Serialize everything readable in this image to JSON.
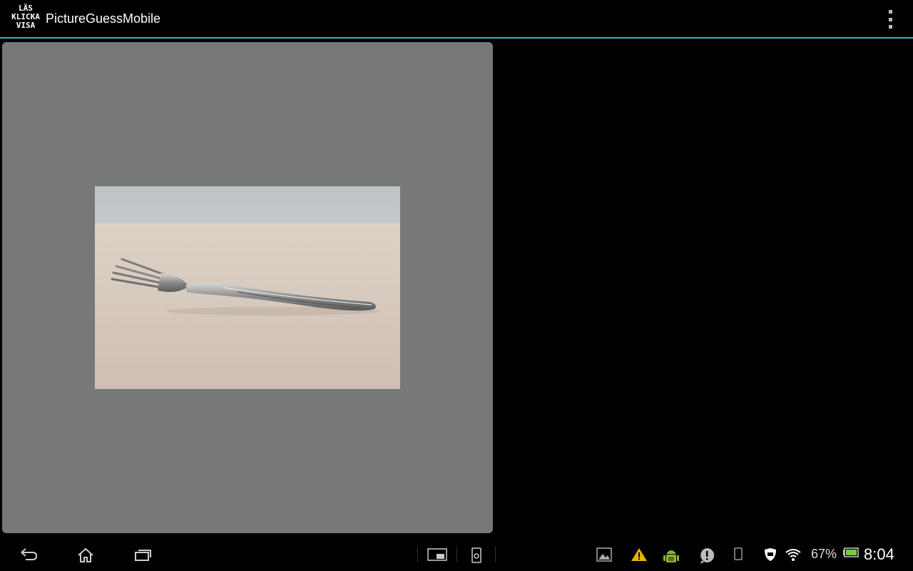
{
  "app": {
    "logo_lines": [
      "LÄS",
      "KLICKA",
      "VISA"
    ],
    "title": "PictureGuessMobile"
  },
  "icons": {
    "overflow": "overflow-menu-icon",
    "back": "back-icon",
    "home": "home-icon",
    "recents": "recent-apps-icon",
    "small_app": "small-apps-icon",
    "screenshot": "screenshot-icon",
    "gallery": "gallery-notification-icon",
    "warning": "warning-notification-icon",
    "android": "android-debug-icon",
    "alert": "alert-notification-icon",
    "device": "device-notification-icon",
    "shield": "security-icon",
    "wifi": "wifi-icon",
    "battery": "battery-icon"
  },
  "content": {
    "image_subject": "fork"
  },
  "status": {
    "battery_percent": "67%",
    "time": "8:04"
  },
  "colors": {
    "accent": "#33b5e5",
    "panel": "#767977",
    "warning": "#e8b400",
    "android": "#8fb23a",
    "battery": "#6fcf3c"
  }
}
